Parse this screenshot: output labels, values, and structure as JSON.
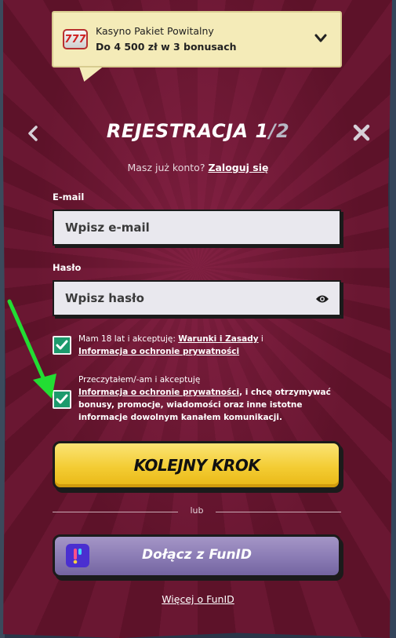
{
  "promo": {
    "title": "Kasyno Pakiet Powitalny",
    "subtitle": "Do 4 500 zł w 3 bonusach",
    "icon": "slot-777-icon",
    "icon_text": "777"
  },
  "header": {
    "title": "REJESTRACJA 1",
    "title_sep": "/",
    "title_total": "2"
  },
  "login": {
    "prompt": "Masz już konto?",
    "link": "Zaloguj się"
  },
  "email": {
    "label": "E-mail",
    "placeholder": "Wpisz e-mail",
    "value": ""
  },
  "password": {
    "label": "Hasło",
    "placeholder": "Wpisz hasło",
    "value": ""
  },
  "consent1": {
    "checked": true,
    "text_before": "Mam 18 lat i akceptuję:",
    "link1": "Warunki i Zasady",
    "joiner": "i",
    "link2": "Informacja o ochronie prywatności"
  },
  "consent2": {
    "checked": true,
    "line1": "Przeczytałem/-am i akceptuję",
    "link": "Informacja o ochronie prywatności",
    "text_after": ", i chcę otrzymywać bonusy, promocje, wiadomości oraz inne istotne informacje dowolnym kanałem komunikacji."
  },
  "actions": {
    "next_label": "KOLEJNY KROK",
    "or_label": "lub",
    "funid_label": "Dołącz z FunID",
    "more_label": "Więcej o FunID"
  },
  "colors": {
    "panel": "#6a1732",
    "primary": "#f3cc33",
    "funid": "#8a7bb4",
    "check": "#1c9a6c",
    "arrow": "#22dd33"
  }
}
